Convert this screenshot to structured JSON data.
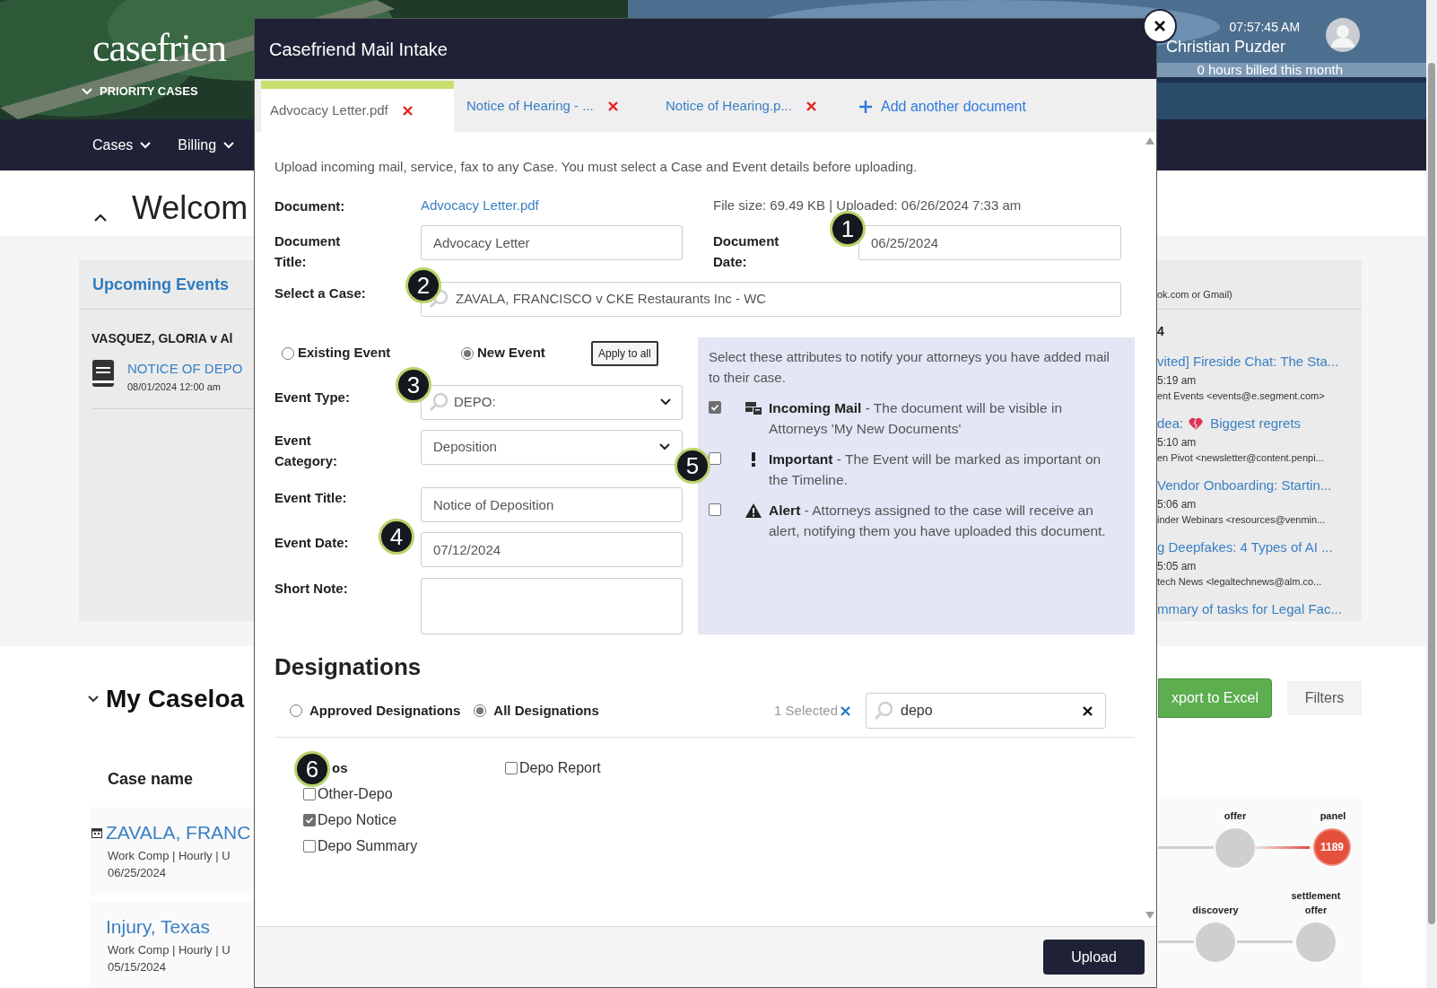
{
  "header": {
    "logo": "casefrien",
    "priority": "PRIORITY CASES",
    "time": "07:57:45 AM",
    "user": "Christian Puzder",
    "billed": "0 hours billed this month"
  },
  "nav": [
    {
      "label": "Cases"
    },
    {
      "label": "Billing"
    }
  ],
  "welcome": {
    "title": "Welcom"
  },
  "upcoming": {
    "title": "Upcoming Events",
    "case": "VASQUEZ, GLORIA v Al",
    "event": "NOTICE OF DEPO",
    "date": "08/01/2024 12:00 am"
  },
  "mail_panel": {
    "note": "ok.com or Gmail)",
    "heading": "4",
    "items": [
      {
        "subject": "vited] Fireside Chat: The Sta...",
        "time": "5:19 am",
        "sender": "ent Events <events@e.segment.com>"
      },
      {
        "subject": "dea:",
        "subject_after_icon": "Biggest regrets",
        "time": "5:10 am",
        "sender": "en Pivot <newsletter@content.penpi..."
      },
      {
        "subject": "Vendor Onboarding: Startin...",
        "time": "5:06 am",
        "sender": "inder Webinars <resources@venmin..."
      },
      {
        "subject": "g Deepfakes: 4 Types of AI ...",
        "time": "5:05 am",
        "sender": "tech News <legaltechnews@alm.co..."
      },
      {
        "subject": "mmary of tasks for Legal Fac..."
      }
    ]
  },
  "caseload": {
    "title": "My Caseloa",
    "export": "xport to Excel",
    "filters": "Filters",
    "column": "Case name",
    "rows": [
      {
        "name": "ZAVALA, FRANC",
        "meta": "Work Comp | Hourly | U",
        "date": "06/25/2024",
        "calendar": true
      },
      {
        "name": "Injury, Texas",
        "meta": "Work Comp | Hourly | U",
        "date": "05/15/2024",
        "calendar": false
      }
    ]
  },
  "timeline": [
    [
      {
        "label": "offer",
        "active": false
      },
      {
        "label": "panel",
        "active": true,
        "badge": "1189"
      }
    ],
    [
      {
        "label": "discovery",
        "active": false
      },
      {
        "label": "settlement offer",
        "active": false
      }
    ]
  ],
  "modal": {
    "title": "Casefriend Mail Intake",
    "tabs": [
      {
        "label": "Advocacy Letter.pdf",
        "selected": true
      },
      {
        "label": "Notice of Hearing - ...",
        "selected": false
      },
      {
        "label": "Notice of Hearing.p...",
        "selected": false
      }
    ],
    "add_document": "Add another document",
    "intro": "Upload incoming mail, service, fax to any Case. You must select a Case and Event details before uploading.",
    "document": {
      "label": "Document:",
      "file": "Advocacy Letter.pdf",
      "info": "File size: 69.49 KB | Uploaded: 06/26/2024 7:33 am"
    },
    "document_title": {
      "label": "Document Title:",
      "value": "Advocacy Letter"
    },
    "document_date": {
      "label": "Document Date:",
      "value": "06/25/2024"
    },
    "case": {
      "label": "Select a Case:",
      "value": "ZAVALA, FRANCISCO v CKE Restaurants Inc - WC"
    },
    "event_modes": [
      {
        "label": "Existing Event",
        "selected": false
      },
      {
        "label": "New Event",
        "selected": true
      }
    ],
    "apply_all": "Apply to all",
    "event_type": {
      "label": "Event Type:",
      "value": "DEPO:"
    },
    "event_category": {
      "label": "Event Category:",
      "value": "Deposition"
    },
    "event_title": {
      "label": "Event Title:",
      "value": "Notice of Deposition"
    },
    "event_date": {
      "label": "Event Date:",
      "value": "07/12/2024"
    },
    "short_note": {
      "label": "Short Note:"
    },
    "notify": {
      "intro": "Select these attributes to notify your attorneys you have added mail to their case.",
      "options": [
        {
          "kind": "mail",
          "text": "**Incoming Mail** - The document will be visible in Attorneys 'My New Documents'",
          "checked": true
        },
        {
          "kind": "important",
          "text": "**Important** - The Event will be marked as important on the Timeline.",
          "checked": false
        },
        {
          "kind": "alert",
          "text": "**Alert** - Attorneys assigned to the case will receive an alert, notifying them you have uploaded this document.",
          "checked": false
        }
      ]
    },
    "designations": {
      "title": "Designations",
      "filters": [
        {
          "label": "Approved Designations",
          "selected": false
        },
        {
          "label": "All Designations",
          "selected": true
        }
      ],
      "selected_count": "1 Selected",
      "search": "depo",
      "columns": [
        [
          {
            "kind": "group",
            "label": "os"
          },
          {
            "kind": "item",
            "label": "Other-Depo",
            "checked": false
          },
          {
            "kind": "item",
            "label": "Depo Notice",
            "checked": true
          },
          {
            "kind": "item",
            "label": "Depo Summary",
            "checked": false
          }
        ],
        [
          {
            "kind": "item",
            "label": "Depo Report",
            "checked": false
          }
        ]
      ]
    },
    "upload": "Upload"
  },
  "callouts": [
    "1",
    "2",
    "3",
    "4",
    "5",
    "6"
  ]
}
